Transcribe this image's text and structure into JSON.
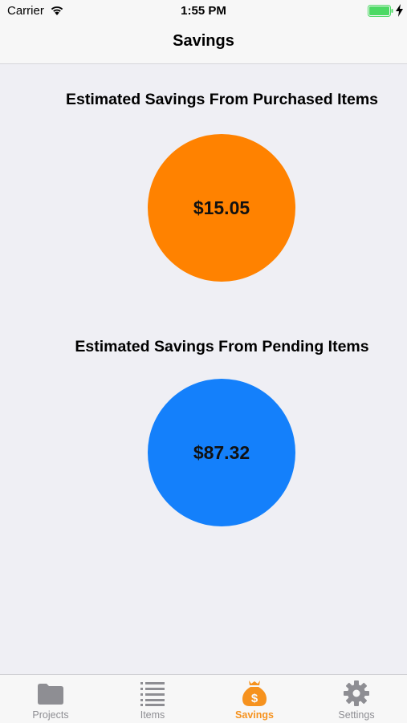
{
  "status_bar": {
    "carrier": "Carrier",
    "time": "1:55 PM",
    "battery_color": "#4CD964"
  },
  "nav": {
    "title": "Savings"
  },
  "purchased": {
    "title": "Estimated Savings From Purchased Items",
    "value": "$15.05",
    "color": "#FF8200"
  },
  "pending": {
    "title": "Estimated Savings From Pending Items",
    "value": "$87.32",
    "color": "#1480FB"
  },
  "tabs": [
    {
      "label": "Projects",
      "icon": "folder-icon",
      "active": false
    },
    {
      "label": "Items",
      "icon": "list-icon",
      "active": false
    },
    {
      "label": "Savings",
      "icon": "money-bag-icon",
      "active": true
    },
    {
      "label": "Settings",
      "icon": "gear-icon",
      "active": false
    }
  ],
  "colors": {
    "tab_active": "#F6921E",
    "tab_inactive": "#8E8E93",
    "background": "#EFEFF4"
  }
}
